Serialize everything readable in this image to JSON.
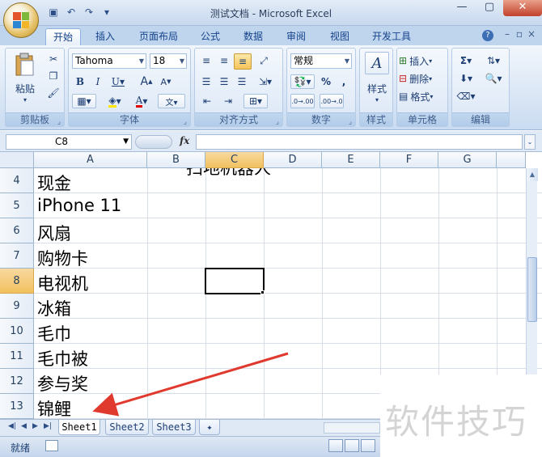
{
  "window": {
    "title": "测试文档 - Microsoft Excel"
  },
  "ribbon": {
    "tabs": [
      "开始",
      "插入",
      "页面布局",
      "公式",
      "数据",
      "审阅",
      "视图",
      "开发工具"
    ],
    "groups": {
      "clipboard": {
        "label": "剪贴板",
        "paste": "粘贴"
      },
      "font": {
        "label": "字体",
        "font_name": "Tahoma",
        "font_size": "18"
      },
      "alignment": {
        "label": "对齐方式"
      },
      "number": {
        "label": "数字",
        "format": "常规"
      },
      "styles": {
        "label": "样式"
      },
      "cells": {
        "label": "单元格",
        "insert": "插入",
        "delete": "删除",
        "format": "格式"
      },
      "editing": {
        "label": "编辑"
      }
    }
  },
  "formula_bar": {
    "name_box": "C8",
    "fx": "fx",
    "value": ""
  },
  "grid": {
    "columns": [
      "A",
      "B",
      "C",
      "D",
      "E",
      "F",
      "G"
    ],
    "selected_column": "C",
    "selected_row": "8",
    "rows": [
      {
        "num": "4",
        "a": "现金"
      },
      {
        "num": "5",
        "a": "iPhone 11"
      },
      {
        "num": "6",
        "a": "风扇"
      },
      {
        "num": "7",
        "a": "购物卡"
      },
      {
        "num": "8",
        "a": "电视机"
      },
      {
        "num": "9",
        "a": "冰箱"
      },
      {
        "num": "10",
        "a": "毛巾"
      },
      {
        "num": "11",
        "a": "毛巾被"
      },
      {
        "num": "12",
        "a": "参与奖"
      },
      {
        "num": "13",
        "a": "锦鲤"
      }
    ],
    "overflow_text": "扫地机器人"
  },
  "sheets": [
    "Sheet1",
    "Sheet2",
    "Sheet3"
  ],
  "status": {
    "ready": "就绪"
  },
  "watermark": "软件技巧",
  "colors": {
    "accent": "#f1c15f",
    "arrow": "#e03a2f"
  }
}
